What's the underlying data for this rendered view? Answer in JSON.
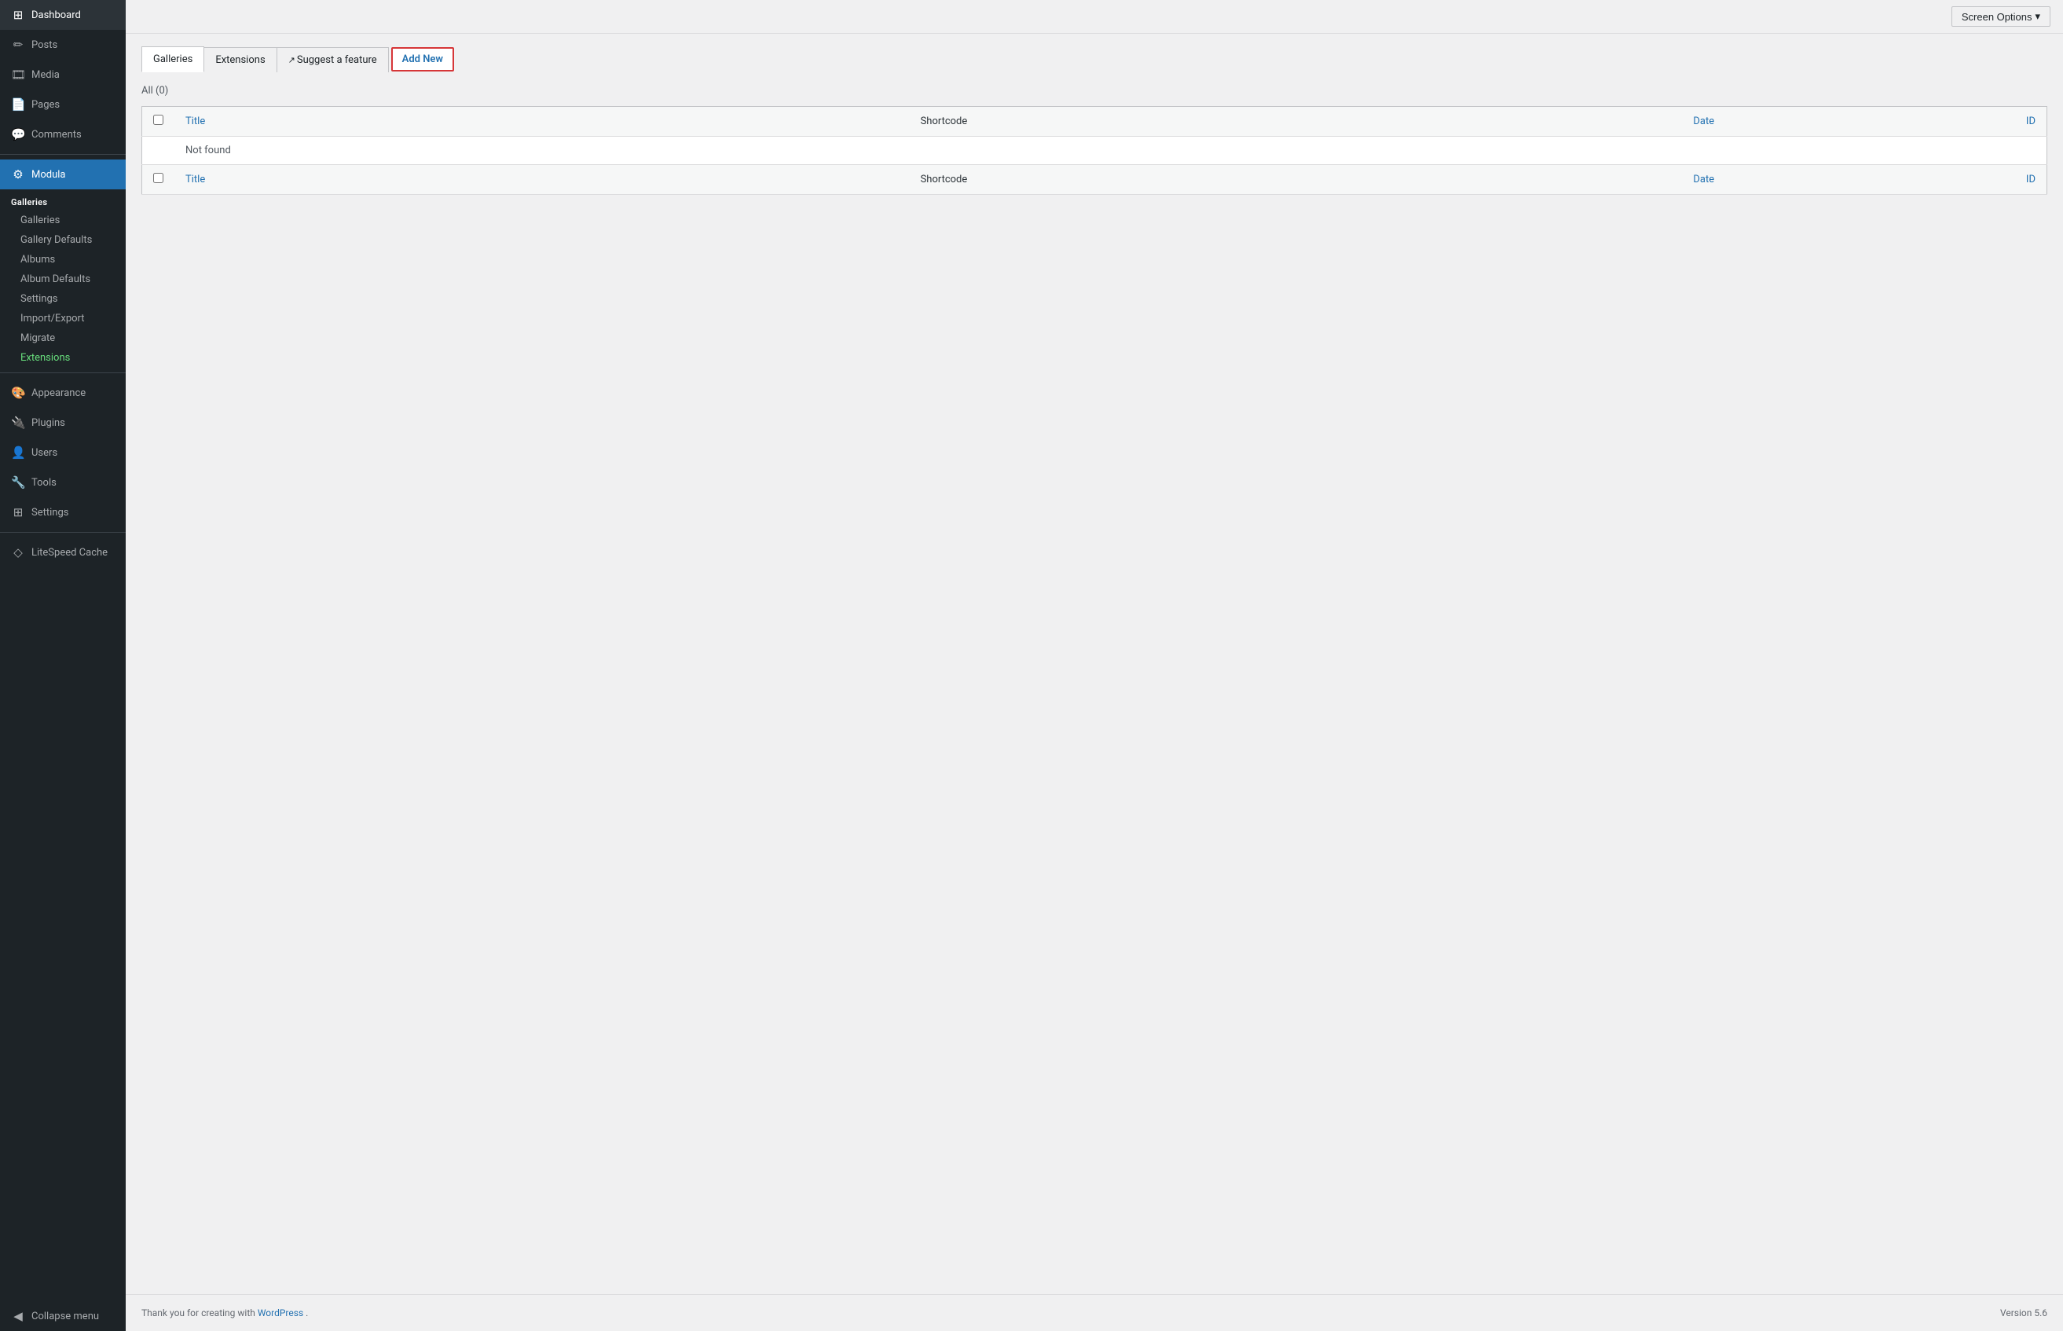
{
  "sidebar": {
    "items": [
      {
        "id": "dashboard",
        "label": "Dashboard",
        "icon": "⊞"
      },
      {
        "id": "posts",
        "label": "Posts",
        "icon": "📝"
      },
      {
        "id": "media",
        "label": "Media",
        "icon": "🖼"
      },
      {
        "id": "pages",
        "label": "Pages",
        "icon": "📄"
      },
      {
        "id": "comments",
        "label": "Comments",
        "icon": "💬"
      },
      {
        "id": "modula",
        "label": "Modula",
        "icon": "⚙"
      }
    ],
    "modula_section": {
      "header": "Galleries",
      "sub_items": [
        {
          "id": "galleries",
          "label": "Galleries"
        },
        {
          "id": "gallery-defaults",
          "label": "Gallery Defaults"
        },
        {
          "id": "albums",
          "label": "Albums"
        },
        {
          "id": "album-defaults",
          "label": "Album Defaults"
        },
        {
          "id": "settings",
          "label": "Settings"
        },
        {
          "id": "import-export",
          "label": "Import/Export"
        },
        {
          "id": "migrate",
          "label": "Migrate"
        },
        {
          "id": "extensions",
          "label": "Extensions"
        }
      ]
    },
    "bottom_items": [
      {
        "id": "appearance",
        "label": "Appearance",
        "icon": "🎨"
      },
      {
        "id": "plugins",
        "label": "Plugins",
        "icon": "🔌"
      },
      {
        "id": "users",
        "label": "Users",
        "icon": "👤"
      },
      {
        "id": "tools",
        "label": "Tools",
        "icon": "🔧"
      },
      {
        "id": "settings",
        "label": "Settings",
        "icon": "⊞"
      },
      {
        "id": "litespeed",
        "label": "LiteSpeed Cache",
        "icon": "◇"
      },
      {
        "id": "collapse",
        "label": "Collapse menu",
        "icon": "◀"
      }
    ]
  },
  "topbar": {
    "screen_options_label": "Screen Options",
    "screen_options_arrow": "▾"
  },
  "tabs": [
    {
      "id": "galleries",
      "label": "Galleries",
      "active": true,
      "icon": ""
    },
    {
      "id": "extensions",
      "label": "Extensions",
      "active": false,
      "icon": ""
    },
    {
      "id": "suggest",
      "label": "Suggest a feature",
      "active": false,
      "icon": "↗"
    },
    {
      "id": "add-new",
      "label": "Add New",
      "active": false,
      "icon": ""
    }
  ],
  "filter": {
    "label": "All",
    "count": "(0)"
  },
  "table": {
    "header": [
      {
        "id": "check",
        "label": ""
      },
      {
        "id": "title",
        "label": "Title"
      },
      {
        "id": "shortcode",
        "label": "Shortcode"
      },
      {
        "id": "date",
        "label": "Date"
      },
      {
        "id": "id",
        "label": "ID"
      }
    ],
    "rows": [],
    "empty_message": "Not found",
    "footer": [
      {
        "id": "check",
        "label": ""
      },
      {
        "id": "title",
        "label": "Title"
      },
      {
        "id": "shortcode",
        "label": "Shortcode"
      },
      {
        "id": "date",
        "label": "Date"
      },
      {
        "id": "id",
        "label": "ID"
      }
    ]
  },
  "footer": {
    "thank_you_text": "Thank you for creating with ",
    "wordpress_link_label": "WordPress",
    "version_label": "Version 5.6"
  }
}
